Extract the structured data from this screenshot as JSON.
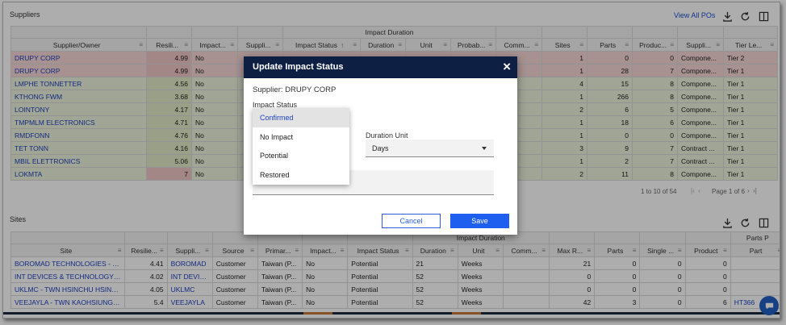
{
  "suppliers": {
    "title": "Suppliers",
    "view_all_label": "View All POs",
    "group_header": "Impact Duration",
    "columns": [
      "Supplier/Owner",
      "Resili...",
      "Impact...",
      "Suppli...",
      "Impact Status",
      "Duration",
      "Unit",
      "Probab...",
      "Comm...",
      "Sites",
      "Parts",
      "Produc...",
      "Suppli...",
      "Tier Le..."
    ],
    "rows": [
      {
        "name": "DRUPY CORP",
        "res": "4.99",
        "impact": "No",
        "sites": "1",
        "parts": "0",
        "prod": "0",
        "sup": "Compone...",
        "tier": "Tier 2"
      },
      {
        "name": "DRUPY CORP",
        "res": "4.99",
        "impact": "No",
        "sites": "1",
        "parts": "28",
        "prod": "7",
        "sup": "Compone...",
        "tier": "Tier 1"
      },
      {
        "name": "LMPHE TONNETTER",
        "res": "4.56",
        "impact": "No",
        "sites": "4",
        "parts": "15",
        "prod": "8",
        "sup": "Compone...",
        "tier": "Tier 1"
      },
      {
        "name": "KTHONG FWM",
        "res": "3.68",
        "impact": "No",
        "sites": "1",
        "parts": "266",
        "prod": "8",
        "sup": "Compone...",
        "tier": "Tier 1"
      },
      {
        "name": "LOINTONY",
        "res": "4.17",
        "impact": "No",
        "sites": "2",
        "parts": "6",
        "prod": "5",
        "sup": "Compone...",
        "tier": "Tier 1"
      },
      {
        "name": "TMPMLM ELECTRONICS",
        "res": "4.71",
        "impact": "No",
        "sites": "1",
        "parts": "18",
        "prod": "6",
        "sup": "Compone...",
        "tier": "Tier 1"
      },
      {
        "name": "RMDFONN",
        "res": "4.76",
        "impact": "No",
        "sites": "1",
        "parts": "0",
        "prod": "0",
        "sup": "Compone...",
        "tier": "Tier 1"
      },
      {
        "name": "TET TONN",
        "res": "4.16",
        "impact": "No",
        "sites": "3",
        "parts": "9",
        "prod": "7",
        "sup": "Contract ...",
        "tier": "Tier 1"
      },
      {
        "name": "MBIL ELETTRONICS",
        "res": "5.06",
        "impact": "No",
        "sites": "1",
        "parts": "2",
        "prod": "7",
        "sup": "Contract ...",
        "tier": "Tier 1"
      },
      {
        "name": "LOKMTA",
        "res": "7",
        "impact": "No",
        "sites": "2",
        "parts": "11",
        "prod": "8",
        "sup": "Compone...",
        "tier": "Tier 1"
      }
    ],
    "pager": {
      "range": "1 to 10 of 54",
      "page": "Page 1 of 6"
    }
  },
  "sites": {
    "title": "Sites",
    "group_header_1": "Impact Duration",
    "group_header_2": "Parts P",
    "columns": [
      "Site",
      "Resilie...",
      "Suppli...",
      "Source",
      "Primar...",
      "Impact...",
      "Impact Status",
      "Duration",
      "Unit",
      "Comm...",
      "Max R...",
      "Parts",
      "Single ...",
      "Product",
      "Part"
    ],
    "rows": [
      {
        "site": "BOROMAD TECHNOLOGIES - TWN",
        "res": "4.41",
        "sup": "BOROMAD",
        "source": "Customer",
        "primary": "Taiwan (P...",
        "impact": "No",
        "status": "Potential",
        "dur": "21",
        "unit": "Weeks",
        "maxr": "21",
        "parts": "0",
        "single": "0",
        "product": "0",
        "part": ""
      },
      {
        "site": "INT DEVICES & TECHNOLOGY - TW",
        "res": "4.02",
        "sup": "INT DEVICE",
        "source": "Customer",
        "primary": "Taiwan (P...",
        "impact": "No",
        "status": "Potential",
        "dur": "52",
        "unit": "Weeks",
        "maxr": "0",
        "parts": "0",
        "single": "0",
        "product": "0",
        "part": ""
      },
      {
        "site": "UKLMC - TWN HSINCHU HSINCHU",
        "res": "4.05",
        "sup": "UKLMC",
        "source": "Customer",
        "primary": "Taiwan (P...",
        "impact": "No",
        "status": "Potential",
        "dur": "52",
        "unit": "Weeks",
        "maxr": "0",
        "parts": "0",
        "single": "0",
        "product": "0",
        "part": ""
      },
      {
        "site": "VEEJAYLA - TWN KAOHSIUNG KAO",
        "res": "5.4",
        "sup": "VEEJAYLA",
        "source": "Customer",
        "primary": "Taiwan (P...",
        "impact": "No",
        "status": "Potential",
        "dur": "52",
        "unit": "Weeks",
        "maxr": "42",
        "parts": "3",
        "single": "0",
        "product": "6",
        "part": "HT366"
      }
    ]
  },
  "modal": {
    "title": "Update Impact Status",
    "close": "×",
    "supplier_label": "Supplier: DRUPY CORP",
    "impact_status_label": "Impact Status",
    "duration_unit_label": "Duration Unit",
    "duration_unit_value": "Days",
    "cancel_label": "Cancel",
    "save_label": "Save",
    "options": [
      "Confirmed",
      "No Impact",
      "Potential",
      "Restored"
    ],
    "selected": "Confirmed"
  },
  "colors": {
    "header_dark": "#0e1f44",
    "link": "#1d3fbf",
    "primary": "#1f5ff0",
    "pink_row": "#f6d6d6"
  }
}
